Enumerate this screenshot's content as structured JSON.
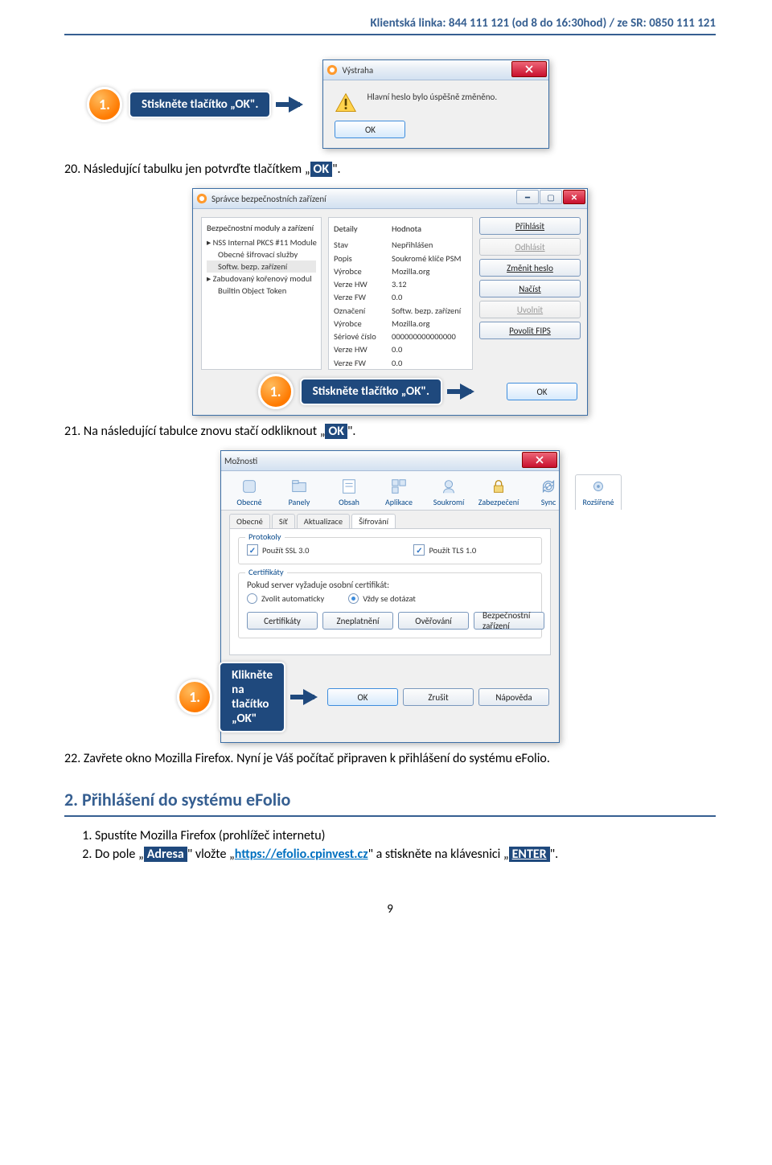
{
  "header_line": "Klientská linka: 844 111 121 (od 8 do 16:30hod) / ze SR: 0850 111 121",
  "callouts": {
    "c1": {
      "num": "1.",
      "label": "Stiskněte tlačítko „OK\"."
    },
    "c2": {
      "num": "1.",
      "label": "Stiskněte tlačítko „OK\"."
    },
    "c3": {
      "num": "1.",
      "label": "Klikněte na tlačítko „OK\""
    }
  },
  "alert": {
    "title": "Výstraha",
    "message": "Hlavní heslo bylo úspěšně změněno.",
    "ok": "OK"
  },
  "step20": {
    "pre": "20. Následující tabulku jen potvrďte tlačítkem „",
    "hl": "OK",
    "post": "\"."
  },
  "devmgr": {
    "title": "Správce bezpečnostních zařízení",
    "col_mods": "Bezpečnostní moduly a zařízení",
    "tree": {
      "n1": "▸ NSS Internal PKCS #11 Module",
      "n1a": "Obecné šifrovací služby",
      "n1b": "Softw. bezp. zařízení",
      "n2": "▸ Zabudovaný kořenový modul",
      "n2a": "Builtin Object Token"
    },
    "col_det": "Detaily",
    "col_val": "Hodnota",
    "details": {
      "stav": {
        "l": "Stav",
        "v": "Nepřihlášen"
      },
      "popis": {
        "l": "Popis",
        "v": "Soukromé klíče PSM"
      },
      "vyrobce": {
        "l": "Výrobce",
        "v": "Mozilla.org"
      },
      "vhw": {
        "l": "Verze HW",
        "v": "3.12"
      },
      "vfw": {
        "l": "Verze FW",
        "v": "0.0"
      },
      "ozn": {
        "l": "Označení",
        "v": "Softw. bezp. zařízení"
      },
      "vyr2": {
        "l": "Výrobce",
        "v": "Mozilla.org"
      },
      "ser": {
        "l": "Sériové číslo",
        "v": "000000000000000"
      },
      "vhw2": {
        "l": "Verze HW",
        "v": "0.0"
      },
      "vfw2": {
        "l": "Verze FW",
        "v": "0.0"
      }
    },
    "btns": {
      "login": "Přihlásit",
      "logout": "Odhlásit",
      "chpw": "Změnit heslo",
      "load": "Načíst",
      "unload": "Uvolnit",
      "fips": "Povolit FIPS"
    },
    "ok": "OK"
  },
  "step21": {
    "pre": "21. Na následující tabulce znovu stačí odkliknout „",
    "hl": "OK",
    "post": "\"."
  },
  "options": {
    "title": "Možnosti",
    "tabs": {
      "obecne": "Obecné",
      "panely": "Panely",
      "obsah": "Obsah",
      "aplikace": "Aplikace",
      "soukromi": "Soukromí",
      "zabezp": "Zabezpečení",
      "sync": "Sync",
      "rozsir": "Rozšířené"
    },
    "subtabs": {
      "obecne": "Obecné",
      "sit": "Síť",
      "aktual": "Aktualizace",
      "sifr": "Šifrování"
    },
    "proto_title": "Protokoly",
    "ssl": "Použít SSL 3.0",
    "tls": "Použít TLS 1.0",
    "cert_title": "Certifikáty",
    "cert_text": "Pokud server vyžaduje osobní certifikát:",
    "cert_auto": "Zvolit automaticky",
    "cert_ask": "Vždy se dotázat",
    "btns": {
      "cert": "Certifikáty",
      "crl": "Zneplatnění",
      "ocsp": "Ověřování",
      "dev": "Bezpečnostní zařízení"
    },
    "ok": "OK",
    "cancel": "Zrušit",
    "help": "Nápověda"
  },
  "step22": "22. Zavřete okno Mozilla Firefox. Nyní je Váš počítač připraven k přihlášení do systému eFolio.",
  "h2": "2. Přihlášení do systému eFolio",
  "list": {
    "i1": "Spustíte Mozilla Firefox (prohlížeč internetu)",
    "i2_pre": "Do pole „",
    "i2_hl1": "Adresa",
    "i2_mid": "\" vložte „",
    "i2_link": "https://efolio.cpinvest.cz",
    "i2_mid2": "\" a stiskněte na klávesnici „",
    "i2_hl2": "ENTER",
    "i2_post": "\"."
  },
  "page_number": "9"
}
